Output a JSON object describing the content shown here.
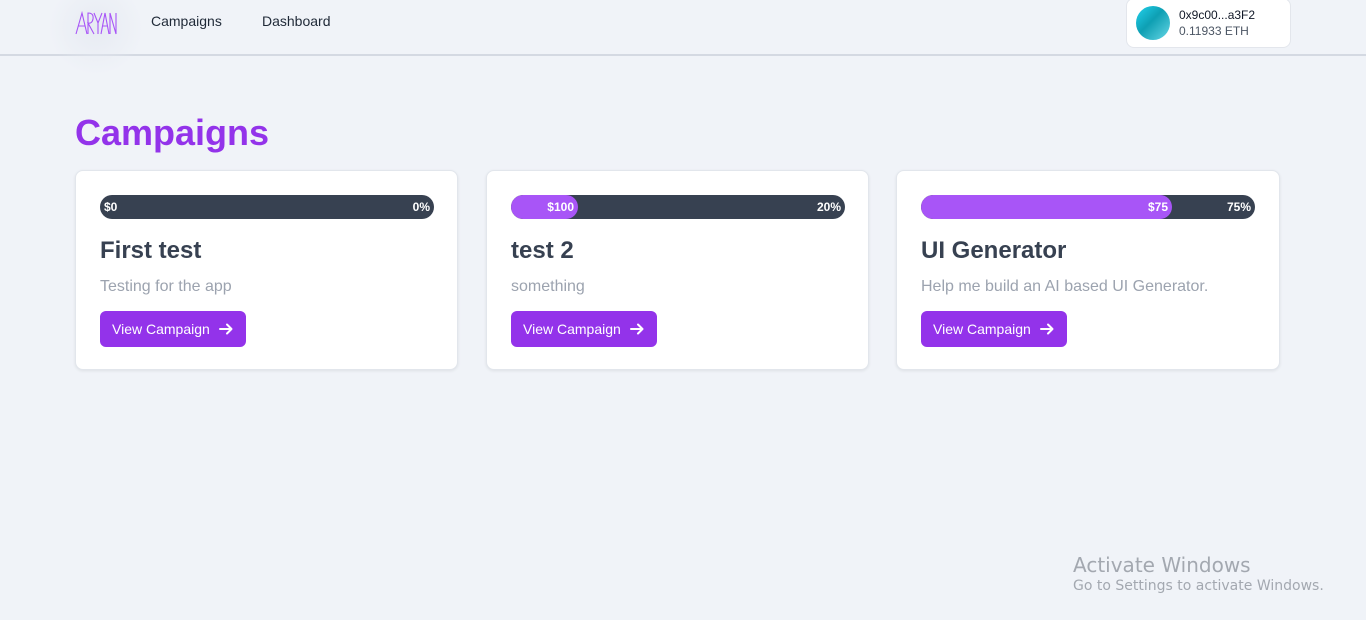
{
  "brand": {
    "logo_text": "ARYAN"
  },
  "nav": {
    "items": [
      {
        "label": "Campaigns"
      },
      {
        "label": "Dashboard"
      }
    ]
  },
  "wallet": {
    "address": "0x9c00...a3F2",
    "balance": "0.11933 ETH"
  },
  "page": {
    "title": "Campaigns"
  },
  "campaigns": [
    {
      "title": "First test",
      "description": "Testing for the app",
      "raised_label": "$0",
      "percent_label": "0%",
      "progress": 0,
      "button_label": "View Campaign"
    },
    {
      "title": "test 2",
      "description": "something",
      "raised_label": "$100",
      "percent_label": "20%",
      "progress": 0.2,
      "button_label": "View Campaign"
    },
    {
      "title": "UI Generator",
      "description": "Help me build an AI based UI Generator.",
      "raised_label": "$75",
      "percent_label": "75%",
      "progress": 0.75,
      "button_label": "View Campaign"
    }
  ],
  "colors": {
    "accent": "#9333ea",
    "progress_fill": "#a855f7",
    "progress_track": "#374151",
    "background": "#f0f3f8"
  },
  "watermark": {
    "title": "Activate Windows",
    "subtitle": "Go to Settings to activate Windows."
  }
}
